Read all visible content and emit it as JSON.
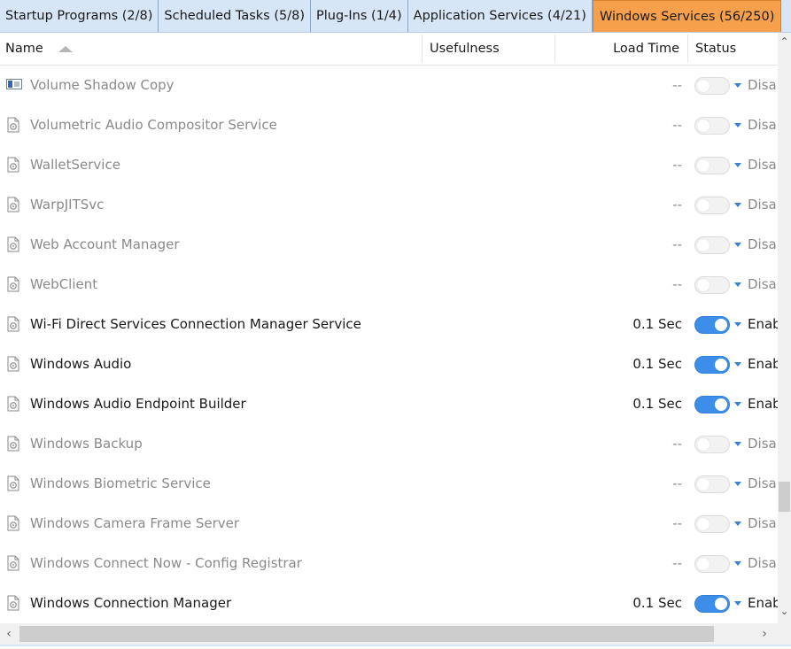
{
  "tabs": [
    {
      "label": "Startup Programs (2/8)",
      "active": false
    },
    {
      "label": "Scheduled Tasks (5/8)",
      "active": false
    },
    {
      "label": "Plug-Ins (1/4)",
      "active": false
    },
    {
      "label": "Application Services (4/21)",
      "active": false
    },
    {
      "label": "Windows Services (56/250)",
      "active": true
    }
  ],
  "columns": {
    "name": "Name",
    "usefulness": "Usefulness",
    "load_time": "Load Time",
    "status": "Status"
  },
  "rows": [
    {
      "name": "Volume Shadow Copy",
      "load": "--",
      "enabled": false,
      "status": "Disa",
      "icon": "volume-shadow-icon"
    },
    {
      "name": "Volumetric Audio Compositor Service",
      "load": "--",
      "enabled": false,
      "status": "Disa",
      "icon": "service-gear-icon"
    },
    {
      "name": "WalletService",
      "load": "--",
      "enabled": false,
      "status": "Disa",
      "icon": "service-gear-icon"
    },
    {
      "name": "WarpJITSvc",
      "load": "--",
      "enabled": false,
      "status": "Disa",
      "icon": "service-gear-icon"
    },
    {
      "name": "Web Account Manager",
      "load": "--",
      "enabled": false,
      "status": "Disa",
      "icon": "service-gear-icon"
    },
    {
      "name": "WebClient",
      "load": "--",
      "enabled": false,
      "status": "Disa",
      "icon": "service-gear-icon"
    },
    {
      "name": "Wi-Fi Direct Services Connection Manager Service",
      "load": "0.1 Sec",
      "enabled": true,
      "status": "Enab",
      "icon": "service-gear-icon"
    },
    {
      "name": "Windows Audio",
      "load": "0.1 Sec",
      "enabled": true,
      "status": "Enab",
      "icon": "service-gear-icon"
    },
    {
      "name": "Windows Audio Endpoint Builder",
      "load": "0.1 Sec",
      "enabled": true,
      "status": "Enab",
      "icon": "service-gear-icon"
    },
    {
      "name": "Windows Backup",
      "load": "--",
      "enabled": false,
      "status": "Disa",
      "icon": "service-gear-icon"
    },
    {
      "name": "Windows Biometric Service",
      "load": "--",
      "enabled": false,
      "status": "Disa",
      "icon": "service-gear-icon"
    },
    {
      "name": "Windows Camera Frame Server",
      "load": "--",
      "enabled": false,
      "status": "Disa",
      "icon": "service-gear-icon"
    },
    {
      "name": "Windows Connect Now - Config Registrar",
      "load": "--",
      "enabled": false,
      "status": "Disa",
      "icon": "service-gear-icon"
    },
    {
      "name": "Windows Connection Manager",
      "load": "0.1 Sec",
      "enabled": true,
      "status": "Enab",
      "icon": "service-gear-icon"
    }
  ],
  "icons": {
    "sort": "sort-ascending-icon",
    "scroll_up": "chevron-up-icon",
    "scroll_down": "chevron-down-icon",
    "scroll_left": "chevron-left-icon",
    "scroll_right": "chevron-right-icon"
  },
  "colors": {
    "tab_bar": "#d7e6f6",
    "tab_active": "#f7a04b",
    "toggle_on": "#3d8ee8",
    "toggle_off": "#f2f2f2",
    "text_disabled": "#8a8a8a"
  }
}
